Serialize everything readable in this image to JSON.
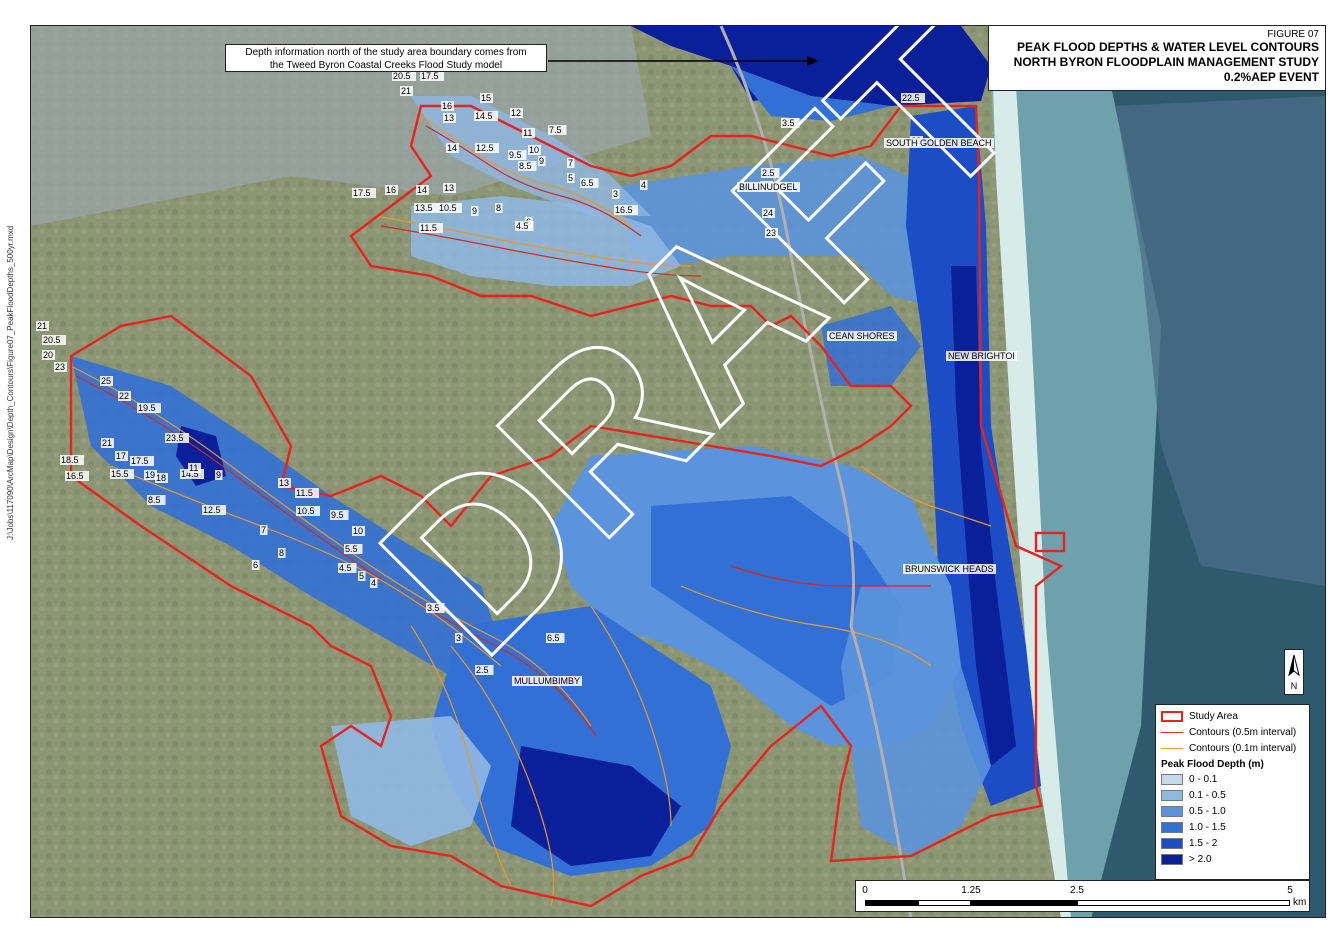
{
  "title": {
    "figure": "FIGURE 07",
    "line1": "PEAK FLOOD DEPTHS & WATER LEVEL CONTOURS",
    "line2": "NORTH BYRON FLOODPLAIN MANAGEMENT STUDY",
    "line3": "0.2%AEP EVENT"
  },
  "note": {
    "line1": "Depth information north of the study area boundary comes from",
    "line2": "the Tweed Byron Coastal Creeks Flood Study model"
  },
  "places": {
    "south_golden_beach": "SOUTH GOLDEN BEACH",
    "billinudgel": "BILLINUDGEL",
    "ocean_shores": "CEAN SHORES",
    "new_brighton": "NEW BRIGHTOI",
    "brunswick_heads": "BRUNSWICK HEADS",
    "mullumbimby": "MULLUMBIMBY"
  },
  "watermark": "DRAFT",
  "file_path": "J:\\Jobs\\117090\\ArcMap\\Design\\Depth_Contours\\Figure07_PeakFloodDepths_500yr.mxd",
  "legend": {
    "study_area": "Study Area",
    "contours_05": "Contours (0.5m interval)",
    "contours_01": "Contours (0.1m interval)",
    "depth_title": "Peak Flood Depth (m)",
    "classes": [
      {
        "label": "0 - 0.1",
        "color": "#c5d9ea"
      },
      {
        "label": "0.1 - 0.5",
        "color": "#8fb8e3"
      },
      {
        "label": "0.5 - 1.0",
        "color": "#5b93dc"
      },
      {
        "label": "1.0 - 1.5",
        "color": "#3370d6"
      },
      {
        "label": "1.5 - 2",
        "color": "#1c4cc6"
      },
      {
        "label": "> 2.0",
        "color": "#0a1f9a"
      }
    ]
  },
  "colors": {
    "study_area": "#e8231e",
    "contour_major": "#d42a1f",
    "contour_minor": "#e89a2a"
  },
  "north": {
    "letter": "N",
    "icon": "north-arrow-icon"
  },
  "scale": {
    "labels": [
      "0",
      "1.25",
      "2.5",
      "5"
    ],
    "unit": "km"
  },
  "contour_labels": [
    "20.5",
    "17.5",
    "21",
    "15",
    "16",
    "14.5",
    "12",
    "13",
    "11",
    "10",
    "9",
    "8.5",
    "7.5",
    "14",
    "12.5",
    "9.5",
    "7",
    "5",
    "6.5",
    "3.5",
    "17.5",
    "16",
    "14",
    "13",
    "13.5",
    "10.5",
    "11.5",
    "9",
    "8",
    "6",
    "4.5",
    "16.5",
    "4",
    "3",
    "2.5",
    "25",
    "24",
    "23",
    "22.5",
    "22",
    "21",
    "20.5",
    "20",
    "23",
    "25",
    "22",
    "19.5",
    "23.5",
    "21",
    "18.5",
    "17",
    "15.5",
    "19",
    "17.5",
    "16.5",
    "18",
    "14.5",
    "11",
    "9",
    "8.5",
    "12.5",
    "13",
    "11.5",
    "10.5",
    "9.5",
    "10",
    "7",
    "8",
    "6",
    "5.5",
    "5",
    "4.5",
    "4",
    "3.5",
    "3",
    "2.5",
    "6.5"
  ]
}
